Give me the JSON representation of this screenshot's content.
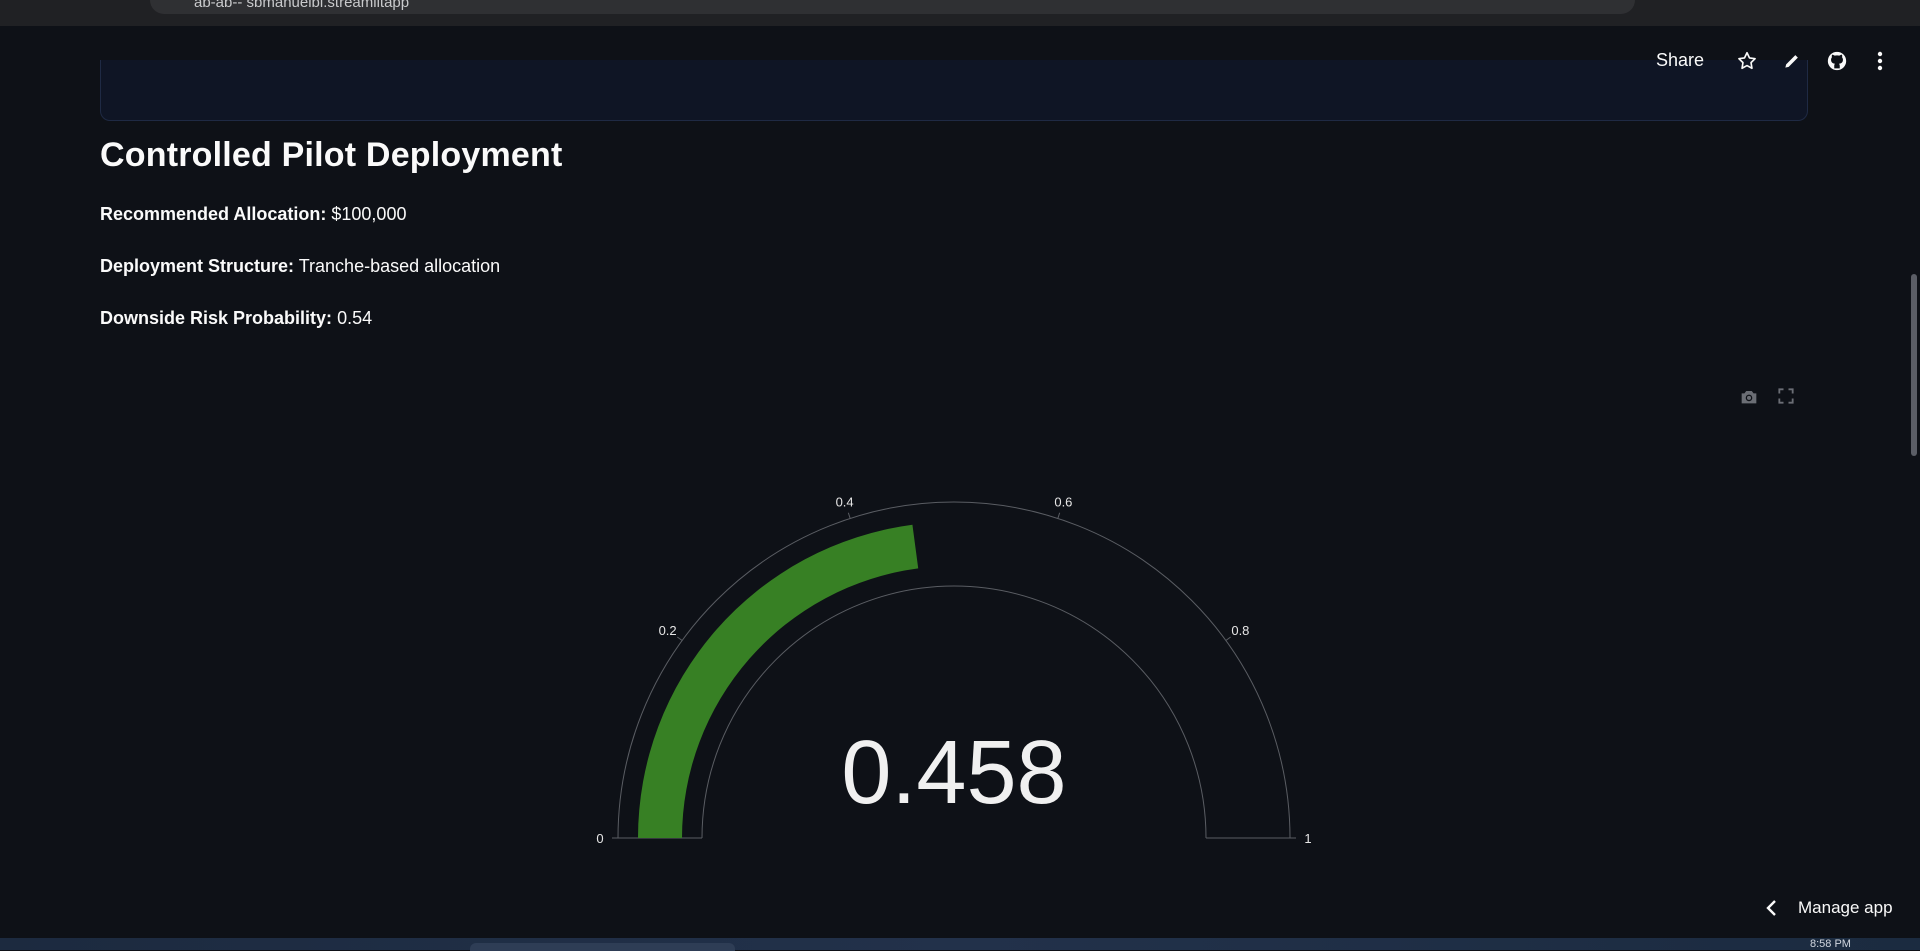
{
  "browser": {
    "url": "ab-ab-- sbmanuelbi.streamlitapp"
  },
  "header": {
    "share_label": "Share",
    "icons": [
      "star-icon",
      "pencil-icon",
      "github-icon",
      "more-vertical-icon"
    ]
  },
  "main": {
    "title": "Controlled Pilot Deployment",
    "fields": [
      {
        "label": "Recommended Allocation:",
        "value": "$100,000"
      },
      {
        "label": "Deployment Structure:",
        "value": "Tranche-based allocation"
      },
      {
        "label": "Downside Risk Probability:",
        "value": "0.54"
      }
    ]
  },
  "chart_data": {
    "type": "gauge",
    "value": 0.458,
    "value_label": "0.458",
    "range": [
      0,
      1
    ],
    "ticks": [
      0,
      0.2,
      0.4,
      0.6,
      0.8,
      1
    ],
    "tick_labels": [
      "0",
      "0.2",
      "0.4",
      "0.6",
      "0.8",
      "1"
    ],
    "bar_color": "#378024",
    "outline_color": "#5a5d63",
    "toolbar_icons": [
      "camera-icon",
      "fullscreen-icon"
    ]
  },
  "footer": {
    "manage_app_label": "Manage app"
  },
  "taskbar": {
    "clock": "8:58 PM"
  }
}
